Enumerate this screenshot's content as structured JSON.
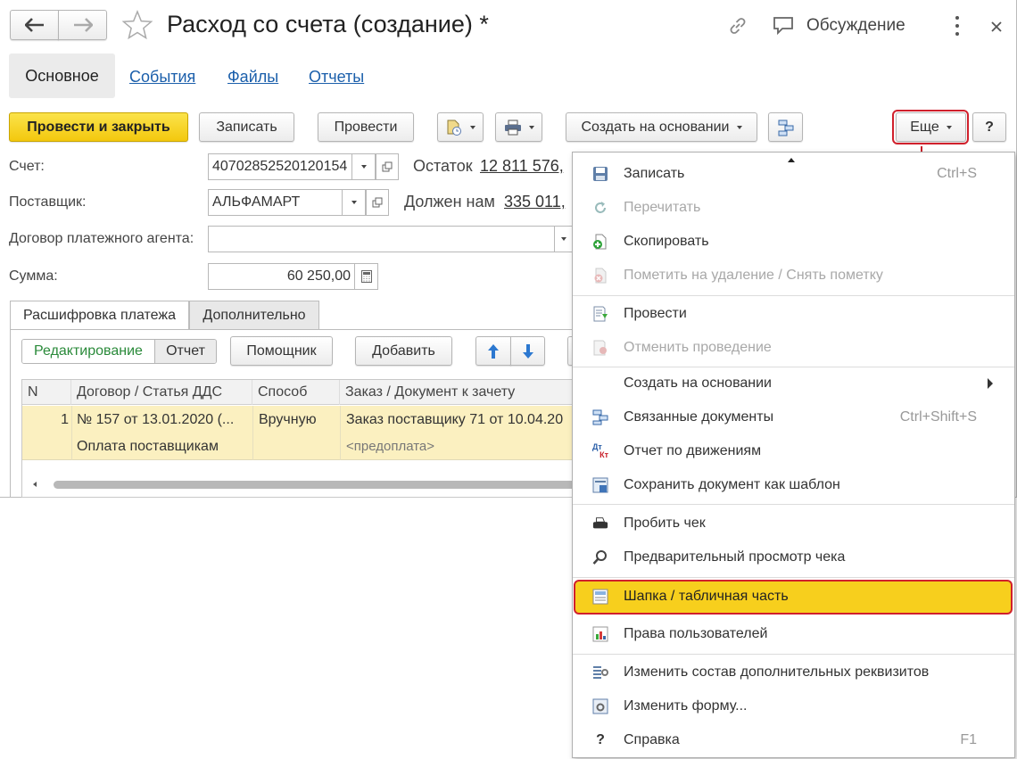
{
  "window": {
    "title": "Расход со счета (создание) *",
    "discussion_label": "Обсуждение"
  },
  "nav_tabs": [
    "Основное",
    "События",
    "Файлы",
    "Отчеты"
  ],
  "toolbar": {
    "post_close": "Провести и закрыть",
    "save": "Записать",
    "post": "Провести",
    "create_based": "Создать на основании",
    "more": "Еще",
    "help": "?"
  },
  "form": {
    "account_label": "Счет:",
    "account_value": "40702852520120154",
    "balance_label": "Остаток",
    "balance_value": "12 811 576,",
    "supplier_label": "Поставщик:",
    "supplier_value": "АЛЬФАМАРТ",
    "owes_label": "Должен нам",
    "owes_value": "335 011,",
    "agent_contract_label": "Договор платежного агента:",
    "agent_contract_value": "",
    "sum_label": "Сумма:",
    "sum_value": "60 250,00"
  },
  "subtabs": [
    "Расшифровка платежа",
    "Дополнительно"
  ],
  "table_toolbar": {
    "edit": "Редактирование",
    "report": "Отчет",
    "helper": "Помощник",
    "add": "Добавить"
  },
  "table": {
    "columns": [
      "N",
      "Договор / Статья ДДС",
      "Способ",
      "Заказ / Документ к зачету"
    ],
    "rows": [
      {
        "n": "1",
        "contract": "№ 157 от 13.01.2020 (...",
        "article": "Оплата поставщикам",
        "method": "Вручную",
        "order": "Заказ поставщику 71 от 10.04.20",
        "doc": "<предоплата>"
      }
    ]
  },
  "menu": {
    "items": [
      {
        "label": "Записать",
        "shortcut": "Ctrl+S",
        "icon": "save-icon"
      },
      {
        "label": "Перечитать",
        "icon": "reload-icon"
      },
      {
        "label": "Скопировать",
        "icon": "copy-icon"
      },
      {
        "label": "Пометить на удаление / Снять пометку",
        "icon": "delete-mark-icon"
      },
      {
        "label": "Провести",
        "icon": "post-icon"
      },
      {
        "label": "Отменить проведение",
        "icon": "unpost-icon"
      },
      {
        "label": "Создать на основании"
      },
      {
        "label": "Связанные документы",
        "shortcut": "Ctrl+Shift+S",
        "icon": "related-docs-icon"
      },
      {
        "label": "Отчет по движениям",
        "icon": "dt-kt-icon",
        "icon_text_dt": "Дт",
        "icon_text_kt": "Кт"
      },
      {
        "label": "Сохранить документ как шаблон",
        "icon": "template-icon"
      },
      {
        "label": "Пробить чек",
        "icon": "receipt-printer-icon"
      },
      {
        "label": "Предварительный просмотр чека",
        "icon": "magnifier-icon"
      },
      {
        "label": "Шапка / табличная часть",
        "icon": "header-table-icon"
      },
      {
        "label": "Права пользователей",
        "icon": "user-rights-icon"
      },
      {
        "label": "Изменить состав дополнительных реквизитов",
        "icon": "gear-list-icon"
      },
      {
        "label": "Изменить форму...",
        "icon": "form-settings-icon"
      },
      {
        "label": "Справка",
        "shortcut": "F1",
        "icon": "help-icon"
      }
    ]
  },
  "colors": {
    "accent_yellow": "#f7cf1d",
    "highlight_red": "#d0202c",
    "link_blue": "#1b5fab",
    "row_yellow": "#fbf0c0"
  }
}
